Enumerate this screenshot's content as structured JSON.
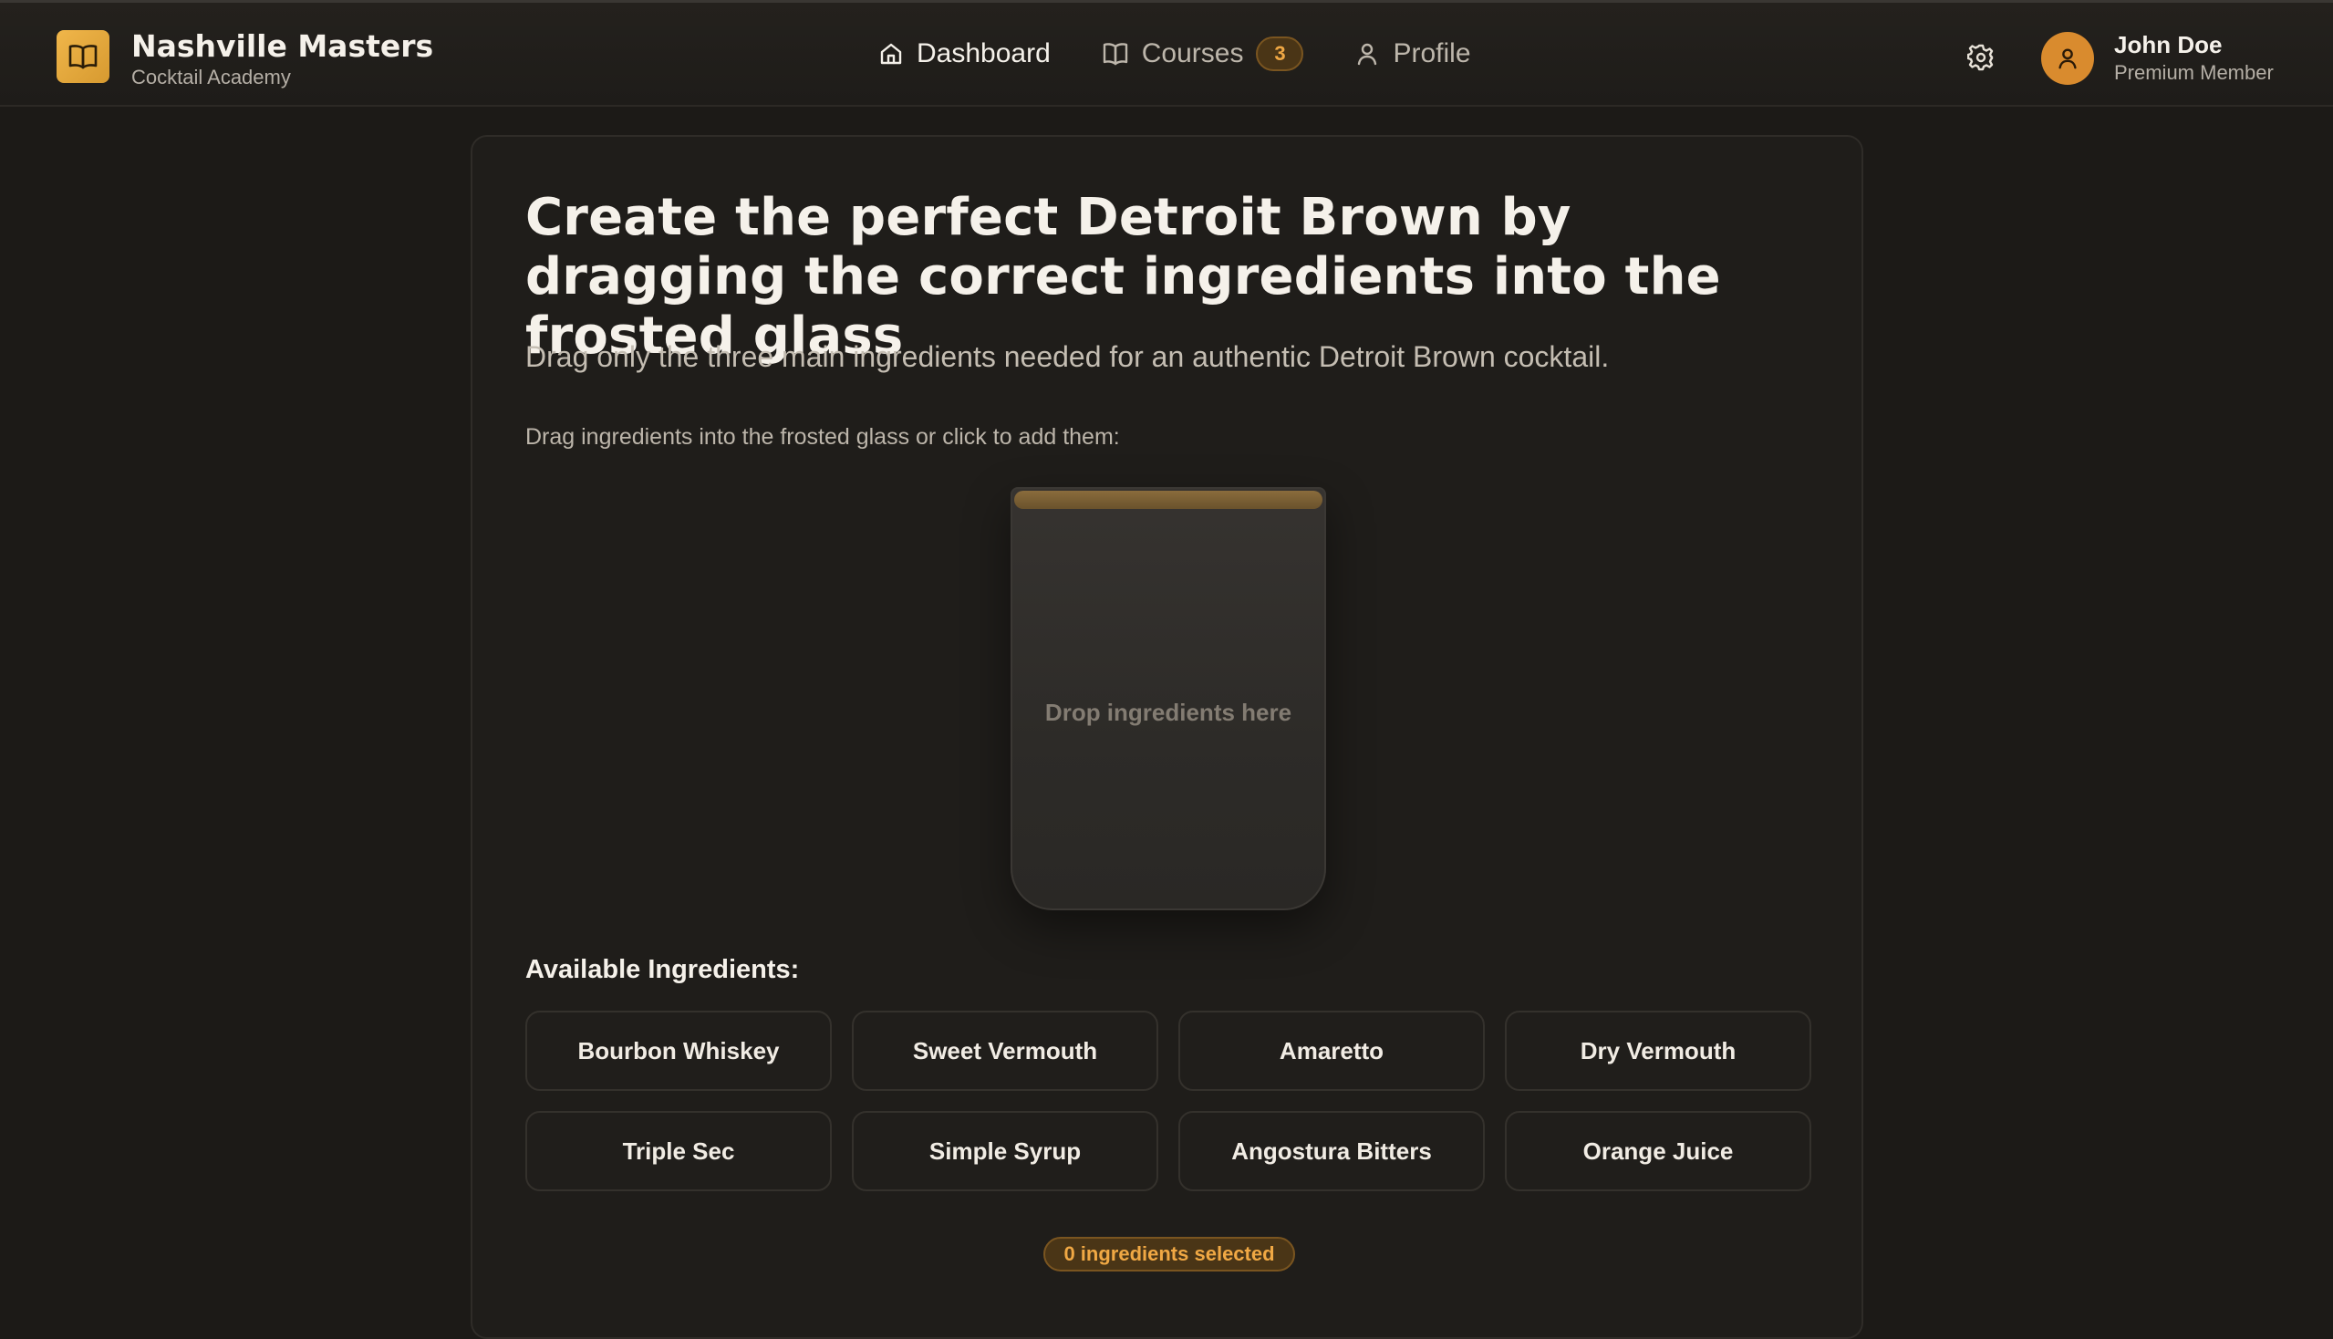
{
  "brand": {
    "name": "Nashville Masters",
    "subtitle": "Cocktail Academy",
    "logo_icon": "open-book-icon",
    "accent": "#e9a93c"
  },
  "nav": {
    "items": [
      {
        "label": "Dashboard",
        "icon": "home-icon",
        "active": true
      },
      {
        "label": "Courses",
        "icon": "book-icon",
        "active": false,
        "badge": "3"
      },
      {
        "label": "Profile",
        "icon": "user-icon",
        "active": false
      }
    ]
  },
  "header": {
    "settings_icon": "gear-icon"
  },
  "user": {
    "name": "John Doe",
    "role": "Premium Member",
    "avatar_icon": "user-icon",
    "avatar_color": "#d98b2e"
  },
  "main": {
    "title": "Create the perfect Detroit Brown by dragging the correct ingredients into the frosted glass",
    "subtitle": "Drag only the three main ingredients needed for an authentic Detroit Brown cocktail.",
    "instruction": "Drag ingredients into the frosted glass or click to add them:",
    "glass": {
      "placeholder": "Drop ingredients here"
    },
    "ingredients_title": "Available Ingredients:",
    "ingredients": [
      "Bourbon Whiskey",
      "Sweet Vermouth",
      "Amaretto",
      "Dry Vermouth",
      "Triple Sec",
      "Simple Syrup",
      "Angostura Bitters",
      "Orange Juice"
    ],
    "status": "0 ingredients selected"
  },
  "colors": {
    "background": "#1c1a17",
    "badge_text": "#f0a844",
    "badge_bg": "#4a3516"
  }
}
